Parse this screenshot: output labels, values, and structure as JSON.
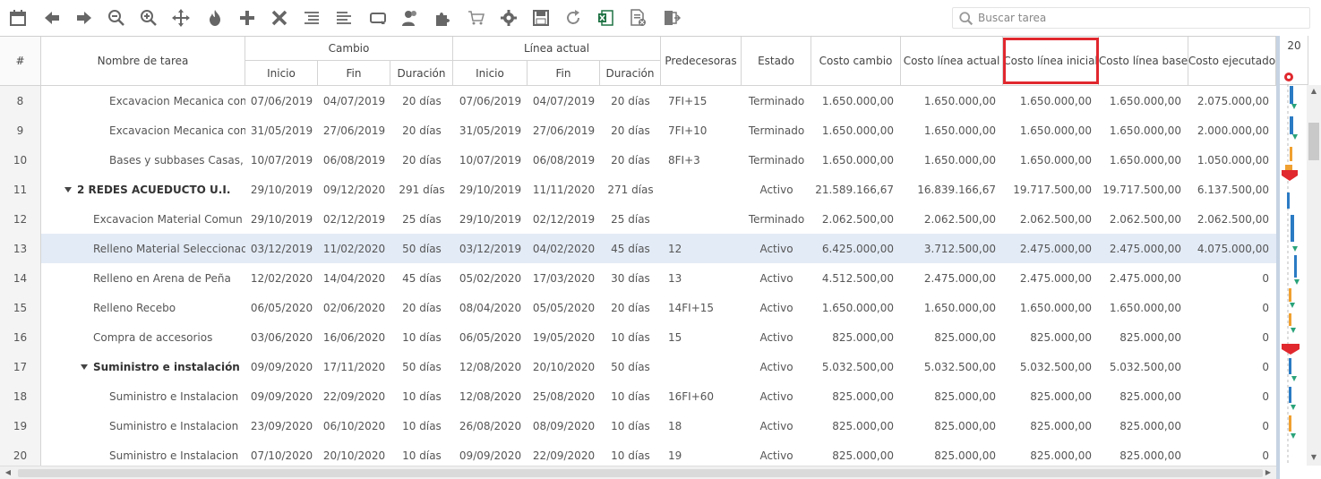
{
  "search": {
    "placeholder": "Buscar tarea"
  },
  "toolbar": {
    "buttons": [
      "calendar-icon",
      "arrow-left-icon",
      "arrow-right-icon",
      "zoom-out-icon",
      "zoom-in-icon",
      "move-icon",
      "fire-icon",
      "plus-icon",
      "close-icon",
      "indent-icon",
      "outdent-icon",
      "link-icon",
      "users-icon",
      "puzzle-icon",
      "cart-icon",
      "gear-icon",
      "save-icon",
      "refresh-icon",
      "excel-icon",
      "document-remove-icon",
      "exit-icon"
    ]
  },
  "header": {
    "num": "#",
    "name": "Nombre de tarea",
    "group_cambio": "Cambio",
    "group_linea": "Línea actual",
    "inicio": "Inicio",
    "fin": "Fin",
    "duracion": "Duración",
    "predecesoras": "Predecesoras",
    "estado": "Estado",
    "costo_cambio": "Costo cambio",
    "costo_linea_actual": "Costo línea actual",
    "costo_linea_inicial": "Costo línea inicial",
    "costo_linea_base": "Costo línea base",
    "costo_ejecutado": "Costo ejecutado"
  },
  "gantt": {
    "year": "20"
  },
  "rows": [
    {
      "id": "8",
      "name": "Excavacion Mecanica con",
      "level": 2,
      "group": false,
      "c_inicio": "07/06/2019",
      "c_fin": "04/07/2019",
      "c_dur": "20 días",
      "l_inicio": "07/06/2019",
      "l_fin": "04/07/2019",
      "l_dur": "20 días",
      "pred": "7FI+15",
      "estado": "Terminado",
      "costo_cambio": "1.650.000,00",
      "costo_actual": "1.650.000,00",
      "costo_inicial": "1.650.000,00",
      "costo_base": "1.650.000,00",
      "costo_ejec": "2.075.000,00"
    },
    {
      "id": "9",
      "name": "Excavacion Mecanica con",
      "level": 2,
      "group": false,
      "c_inicio": "31/05/2019",
      "c_fin": "27/06/2019",
      "c_dur": "20 días",
      "l_inicio": "31/05/2019",
      "l_fin": "27/06/2019",
      "l_dur": "20 días",
      "pred": "7FI+10",
      "estado": "Terminado",
      "costo_cambio": "1.650.000,00",
      "costo_actual": "1.650.000,00",
      "costo_inicial": "1.650.000,00",
      "costo_base": "1.650.000,00",
      "costo_ejec": "2.000.000,00"
    },
    {
      "id": "10",
      "name": "Bases y subbases Casas,",
      "level": 2,
      "group": false,
      "c_inicio": "10/07/2019",
      "c_fin": "06/08/2019",
      "c_dur": "20 días",
      "l_inicio": "10/07/2019",
      "l_fin": "06/08/2019",
      "l_dur": "20 días",
      "pred": "8FI+3",
      "estado": "Terminado",
      "costo_cambio": "1.650.000,00",
      "costo_actual": "1.650.000,00",
      "costo_inicial": "1.650.000,00",
      "costo_base": "1.650.000,00",
      "costo_ejec": "1.050.000,00"
    },
    {
      "id": "11",
      "name": "2 REDES ACUEDUCTO U.I.",
      "level": 0,
      "group": true,
      "c_inicio": "29/10/2019",
      "c_fin": "09/12/2020",
      "c_dur": "291 días",
      "l_inicio": "29/10/2019",
      "l_fin": "11/11/2020",
      "l_dur": "271 días",
      "pred": "",
      "estado": "Activo",
      "costo_cambio": "21.589.166,67",
      "costo_actual": "16.839.166,67",
      "costo_inicial": "19.717.500,00",
      "costo_base": "19.717.500,00",
      "costo_ejec": "6.137.500,00"
    },
    {
      "id": "12",
      "name": "Excavacion Material Comun",
      "level": 1,
      "group": false,
      "c_inicio": "29/10/2019",
      "c_fin": "02/12/2019",
      "c_dur": "25 días",
      "l_inicio": "29/10/2019",
      "l_fin": "02/12/2019",
      "l_dur": "25 días",
      "pred": "",
      "estado": "Terminado",
      "costo_cambio": "2.062.500,00",
      "costo_actual": "2.062.500,00",
      "costo_inicial": "2.062.500,00",
      "costo_base": "2.062.500,00",
      "costo_ejec": "2.062.500,00"
    },
    {
      "id": "13",
      "name": "Relleno Material Seleccionad",
      "level": 1,
      "group": false,
      "selected": true,
      "c_inicio": "03/12/2019",
      "c_fin": "11/02/2020",
      "c_dur": "50 días",
      "l_inicio": "03/12/2019",
      "l_fin": "04/02/2020",
      "l_dur": "45 días",
      "pred": "12",
      "estado": "Activo",
      "costo_cambio": "6.425.000,00",
      "costo_actual": "3.712.500,00",
      "costo_inicial": "2.475.000,00",
      "costo_base": "2.475.000,00",
      "costo_ejec": "4.075.000,00"
    },
    {
      "id": "14",
      "name": "Relleno en Arena de Peña",
      "level": 1,
      "group": false,
      "c_inicio": "12/02/2020",
      "c_fin": "14/04/2020",
      "c_dur": "45 días",
      "l_inicio": "05/02/2020",
      "l_fin": "17/03/2020",
      "l_dur": "30 días",
      "pred": "13",
      "estado": "Activo",
      "costo_cambio": "4.512.500,00",
      "costo_actual": "2.475.000,00",
      "costo_inicial": "2.475.000,00",
      "costo_base": "2.475.000,00",
      "costo_ejec": "0"
    },
    {
      "id": "15",
      "name": "Relleno Recebo",
      "level": 1,
      "group": false,
      "c_inicio": "06/05/2020",
      "c_fin": "02/06/2020",
      "c_dur": "20 días",
      "l_inicio": "08/04/2020",
      "l_fin": "05/05/2020",
      "l_dur": "20 días",
      "pred": "14FI+15",
      "estado": "Activo",
      "costo_cambio": "1.650.000,00",
      "costo_actual": "1.650.000,00",
      "costo_inicial": "1.650.000,00",
      "costo_base": "1.650.000,00",
      "costo_ejec": "0"
    },
    {
      "id": "16",
      "name": "Compra de accesorios",
      "level": 1,
      "group": false,
      "c_inicio": "03/06/2020",
      "c_fin": "16/06/2020",
      "c_dur": "10 días",
      "l_inicio": "06/05/2020",
      "l_fin": "19/05/2020",
      "l_dur": "10 días",
      "pred": "15",
      "estado": "Activo",
      "costo_cambio": "825.000,00",
      "costo_actual": "825.000,00",
      "costo_inicial": "825.000,00",
      "costo_base": "825.000,00",
      "costo_ejec": "0"
    },
    {
      "id": "17",
      "name": "Suministro e instalación",
      "level": 1,
      "group": true,
      "c_inicio": "09/09/2020",
      "c_fin": "17/11/2020",
      "c_dur": "50 días",
      "l_inicio": "12/08/2020",
      "l_fin": "20/10/2020",
      "l_dur": "50 días",
      "pred": "",
      "estado": "Activo",
      "costo_cambio": "5.032.500,00",
      "costo_actual": "5.032.500,00",
      "costo_inicial": "5.032.500,00",
      "costo_base": "5.032.500,00",
      "costo_ejec": "0"
    },
    {
      "id": "18",
      "name": "Suministro e Instalacion",
      "level": 2,
      "group": false,
      "c_inicio": "09/09/2020",
      "c_fin": "22/09/2020",
      "c_dur": "10 días",
      "l_inicio": "12/08/2020",
      "l_fin": "25/08/2020",
      "l_dur": "10 días",
      "pred": "16FI+60",
      "estado": "Activo",
      "costo_cambio": "825.000,00",
      "costo_actual": "825.000,00",
      "costo_inicial": "825.000,00",
      "costo_base": "825.000,00",
      "costo_ejec": "0"
    },
    {
      "id": "19",
      "name": "Suministro e Instalacion",
      "level": 2,
      "group": false,
      "c_inicio": "23/09/2020",
      "c_fin": "06/10/2020",
      "c_dur": "10 días",
      "l_inicio": "26/08/2020",
      "l_fin": "08/09/2020",
      "l_dur": "10 días",
      "pred": "18",
      "estado": "Activo",
      "costo_cambio": "825.000,00",
      "costo_actual": "825.000,00",
      "costo_inicial": "825.000,00",
      "costo_base": "825.000,00",
      "costo_ejec": "0"
    },
    {
      "id": "20",
      "name": "Suministro e Instalacion",
      "level": 2,
      "group": false,
      "c_inicio": "07/10/2020",
      "c_fin": "20/10/2020",
      "c_dur": "10 días",
      "l_inicio": "09/09/2020",
      "l_fin": "22/09/2020",
      "l_dur": "10 días",
      "pred": "19",
      "estado": "Activo",
      "costo_cambio": "825.000,00",
      "costo_actual": "825.000,00",
      "costo_inicial": "825.000,00",
      "costo_base": "825.000,00",
      "costo_ejec": "0"
    }
  ]
}
